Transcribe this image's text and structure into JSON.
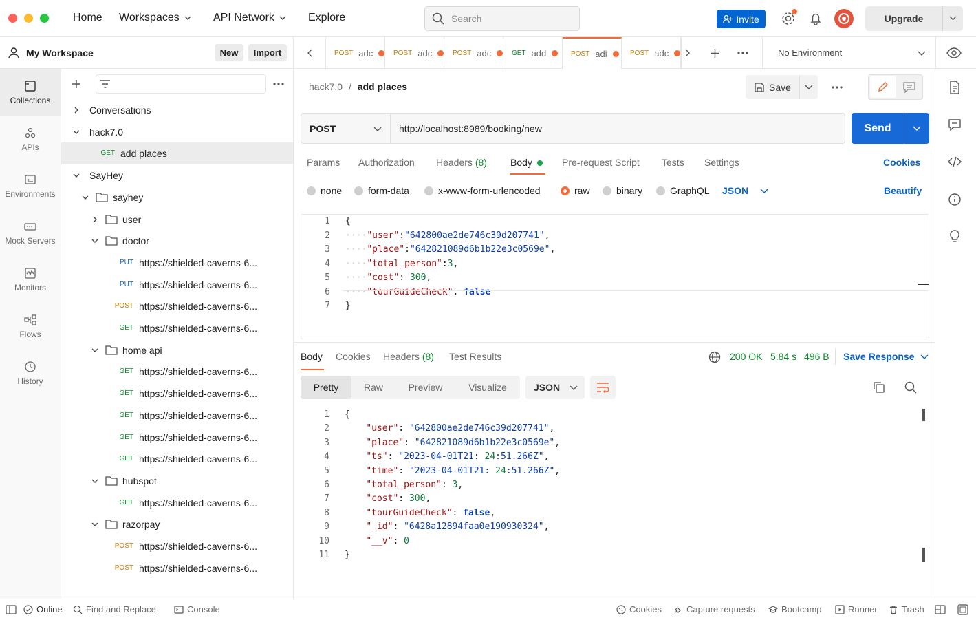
{
  "header": {
    "nav": [
      "Home",
      "Workspaces",
      "API Network",
      "Explore"
    ],
    "search_placeholder": "Search",
    "invite_label": "Invite",
    "upgrade_label": "Upgrade"
  },
  "workspace": {
    "name": "My Workspace",
    "new_label": "New",
    "import_label": "Import"
  },
  "rail": [
    "Collections",
    "APIs",
    "Environments",
    "Mock Servers",
    "Monitors",
    "Flows",
    "History"
  ],
  "tree": [
    {
      "label": "Conversations",
      "depth": 0,
      "type": "collection",
      "expanded": false
    },
    {
      "label": "hack7.0",
      "depth": 0,
      "type": "collection",
      "expanded": true
    },
    {
      "label": "add places",
      "depth": 1,
      "type": "request",
      "method": "GET",
      "selected": true
    },
    {
      "label": "SayHey",
      "depth": 0,
      "type": "collection",
      "expanded": true
    },
    {
      "label": "sayhey",
      "depth": 1,
      "type": "folder",
      "expanded": true
    },
    {
      "label": "user",
      "depth": 2,
      "type": "folder",
      "expanded": false
    },
    {
      "label": "doctor",
      "depth": 2,
      "type": "folder",
      "expanded": true
    },
    {
      "label": "https://shielded-caverns-6...",
      "depth": 3,
      "type": "request",
      "method": "PUT"
    },
    {
      "label": "https://shielded-caverns-6...",
      "depth": 3,
      "type": "request",
      "method": "PUT"
    },
    {
      "label": "https://shielded-caverns-6...",
      "depth": 3,
      "type": "request",
      "method": "POST"
    },
    {
      "label": "https://shielded-caverns-6...",
      "depth": 3,
      "type": "request",
      "method": "GET"
    },
    {
      "label": "home api",
      "depth": 2,
      "type": "folder",
      "expanded": true
    },
    {
      "label": "https://shielded-caverns-6...",
      "depth": 3,
      "type": "request",
      "method": "GET"
    },
    {
      "label": "https://shielded-caverns-6...",
      "depth": 3,
      "type": "request",
      "method": "GET"
    },
    {
      "label": "https://shielded-caverns-6...",
      "depth": 3,
      "type": "request",
      "method": "GET"
    },
    {
      "label": "https://shielded-caverns-6...",
      "depth": 3,
      "type": "request",
      "method": "GET"
    },
    {
      "label": "https://shielded-caverns-6...",
      "depth": 3,
      "type": "request",
      "method": "GET"
    },
    {
      "label": "hubspot",
      "depth": 2,
      "type": "folder",
      "expanded": true
    },
    {
      "label": "https://shielded-caverns-6...",
      "depth": 3,
      "type": "request",
      "method": "GET"
    },
    {
      "label": "razorpay",
      "depth": 2,
      "type": "folder",
      "expanded": true
    },
    {
      "label": "https://shielded-caverns-6...",
      "depth": 3,
      "type": "request",
      "method": "POST"
    },
    {
      "label": "https://shielded-caverns-6...",
      "depth": 3,
      "type": "request",
      "method": "POST"
    }
  ],
  "tabs": [
    {
      "method": "POST",
      "name": "adc"
    },
    {
      "method": "POST",
      "name": "adc"
    },
    {
      "method": "POST",
      "name": "adc"
    },
    {
      "method": "GET",
      "name": "add"
    },
    {
      "method": "POST",
      "name": "adi",
      "active": true
    },
    {
      "method": "POST",
      "name": "adc"
    }
  ],
  "environment": "No Environment",
  "request": {
    "collection": "hack7.0",
    "separator": "/",
    "name": "add places",
    "save_label": "Save",
    "method": "POST",
    "url": "http://localhost:8989/booking/new",
    "send_label": "Send",
    "tabs": {
      "params": "Params",
      "authorization": "Authorization",
      "headers": "Headers",
      "headers_count": "(8)",
      "body": "Body",
      "prerequest": "Pre-request Script",
      "tests": "Tests",
      "settings": "Settings"
    },
    "cookies_label": "Cookies",
    "body_modes": [
      "none",
      "form-data",
      "x-www-form-urlencoded",
      "raw",
      "binary",
      "GraphQL"
    ],
    "selected_mode": "raw",
    "language": "JSON",
    "beautify_label": "Beautify",
    "body_lines": [
      "{",
      "    \"user\":\"642800ae2de746c39d207741\",",
      "    \"place\":\"642821089d6b1b22e3c0569e\",",
      "    \"total_person\":3,",
      "    \"cost\": 300,",
      "    \"tourGuideCheck\": false",
      "}"
    ]
  },
  "response": {
    "tabs": {
      "body": "Body",
      "cookies": "Cookies",
      "headers": "Headers",
      "headers_count": "(8)",
      "tests": "Test Results"
    },
    "status": "200 OK",
    "time": "5.84 s",
    "size": "496 B",
    "save_label": "Save Response",
    "views": [
      "Pretty",
      "Raw",
      "Preview",
      "Visualize"
    ],
    "format": "JSON",
    "body_lines": [
      "{",
      "    \"user\": \"642800ae2de746c39d207741\",",
      "    \"place\": \"642821089d6b1b22e3c0569e\",",
      "    \"ts\": \"2023-04-01T21:24:51.266Z\",",
      "    \"time\": \"2023-04-01T21:24:51.266Z\",",
      "    \"total_person\": 3,",
      "    \"cost\": 300,",
      "    \"tourGuideCheck\": false,",
      "    \"_id\": \"6428a12894faa0e190930324\",",
      "    \"__v\": 0",
      "}"
    ]
  },
  "footer": {
    "online": "Online",
    "find_replace": "Find and Replace",
    "console": "Console",
    "cookies": "Cookies",
    "capture": "Capture requests",
    "bootcamp": "Bootcamp",
    "runner": "Runner",
    "trash": "Trash"
  },
  "colors": {
    "accent": "#f26b3a",
    "send": "#1769d8",
    "invite": "#0265d2",
    "status_ok": "#0f8a2f",
    "link": "#0a62c5"
  }
}
